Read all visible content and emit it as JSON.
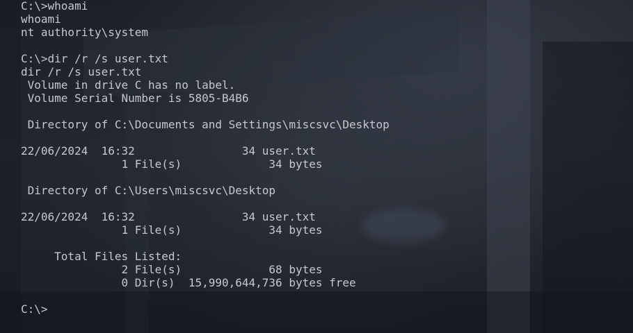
{
  "terminal": {
    "lines": [
      "C:\\>whoami",
      "whoami",
      "nt authority\\system",
      "",
      "C:\\>dir /r /s user.txt",
      "dir /r /s user.txt",
      " Volume in drive C has no label.",
      " Volume Serial Number is 5805-B4B6",
      "",
      " Directory of C:\\Documents and Settings\\miscsvc\\Desktop",
      "",
      "22/06/2024  16:32                34 user.txt",
      "               1 File(s)             34 bytes",
      "",
      " Directory of C:\\Users\\miscsvc\\Desktop",
      "",
      "22/06/2024  16:32                34 user.txt",
      "               1 File(s)             34 bytes",
      "",
      "     Total Files Listed:",
      "               2 File(s)             68 bytes",
      "               0 Dir(s)  15,990,644,736 bytes free",
      "",
      "C:\\>"
    ]
  }
}
